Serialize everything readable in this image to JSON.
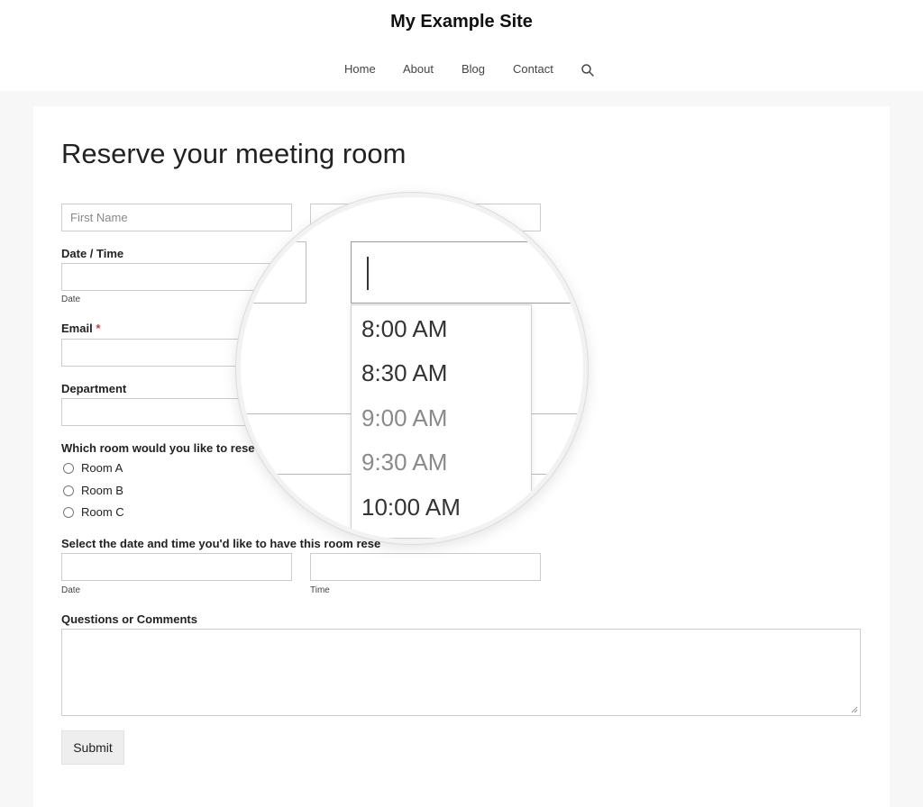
{
  "site": {
    "title": "My Example Site"
  },
  "nav": {
    "items": [
      "Home",
      "About",
      "Blog",
      "Contact"
    ],
    "search_icon": "search-icon"
  },
  "form": {
    "title": "Reserve your meeting room",
    "first_name_placeholder": "First Name",
    "date_time_label": "Date / Time",
    "date_sublabel": "Date",
    "email_label": "Email",
    "required_marker": "*",
    "department_label": "Department",
    "room_question": "Which room would you like to rese",
    "rooms": [
      "Room A",
      "Room B",
      "Room C"
    ],
    "select_date_label": "Select the date and time you'd like to have this room rese",
    "reserve_date_sublabel": "Date",
    "reserve_time_sublabel": "Time",
    "comments_label": "Questions or Comments",
    "submit_label": "Submit"
  },
  "time_dropdown": {
    "options": [
      "8:00 AM",
      "8:30 AM",
      "9:00 AM",
      "9:30 AM",
      "10:00 AM"
    ]
  },
  "colors": {
    "required": "#d63638",
    "muted_option": "#8a8a8a"
  }
}
